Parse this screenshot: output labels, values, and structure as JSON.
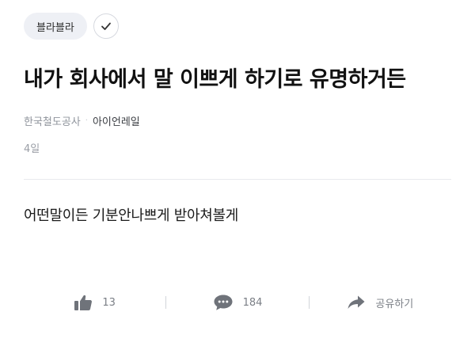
{
  "post": {
    "category": "블라블라",
    "title": "내가 회사에서 말 이쁘게 하기로 유명하거든",
    "company": "한국철도공사",
    "separator": "·",
    "nickname": "아이언레일",
    "date": "4일",
    "content": "어떤말이든 기분안나쁘게 받아쳐볼게"
  },
  "actions": {
    "like_count": "13",
    "comment_count": "184",
    "share_label": "공유하기"
  },
  "colors": {
    "chip_bg": "#eef0f5",
    "icon_gray": "#6f737a",
    "meta_gray": "#9a9ea6"
  }
}
